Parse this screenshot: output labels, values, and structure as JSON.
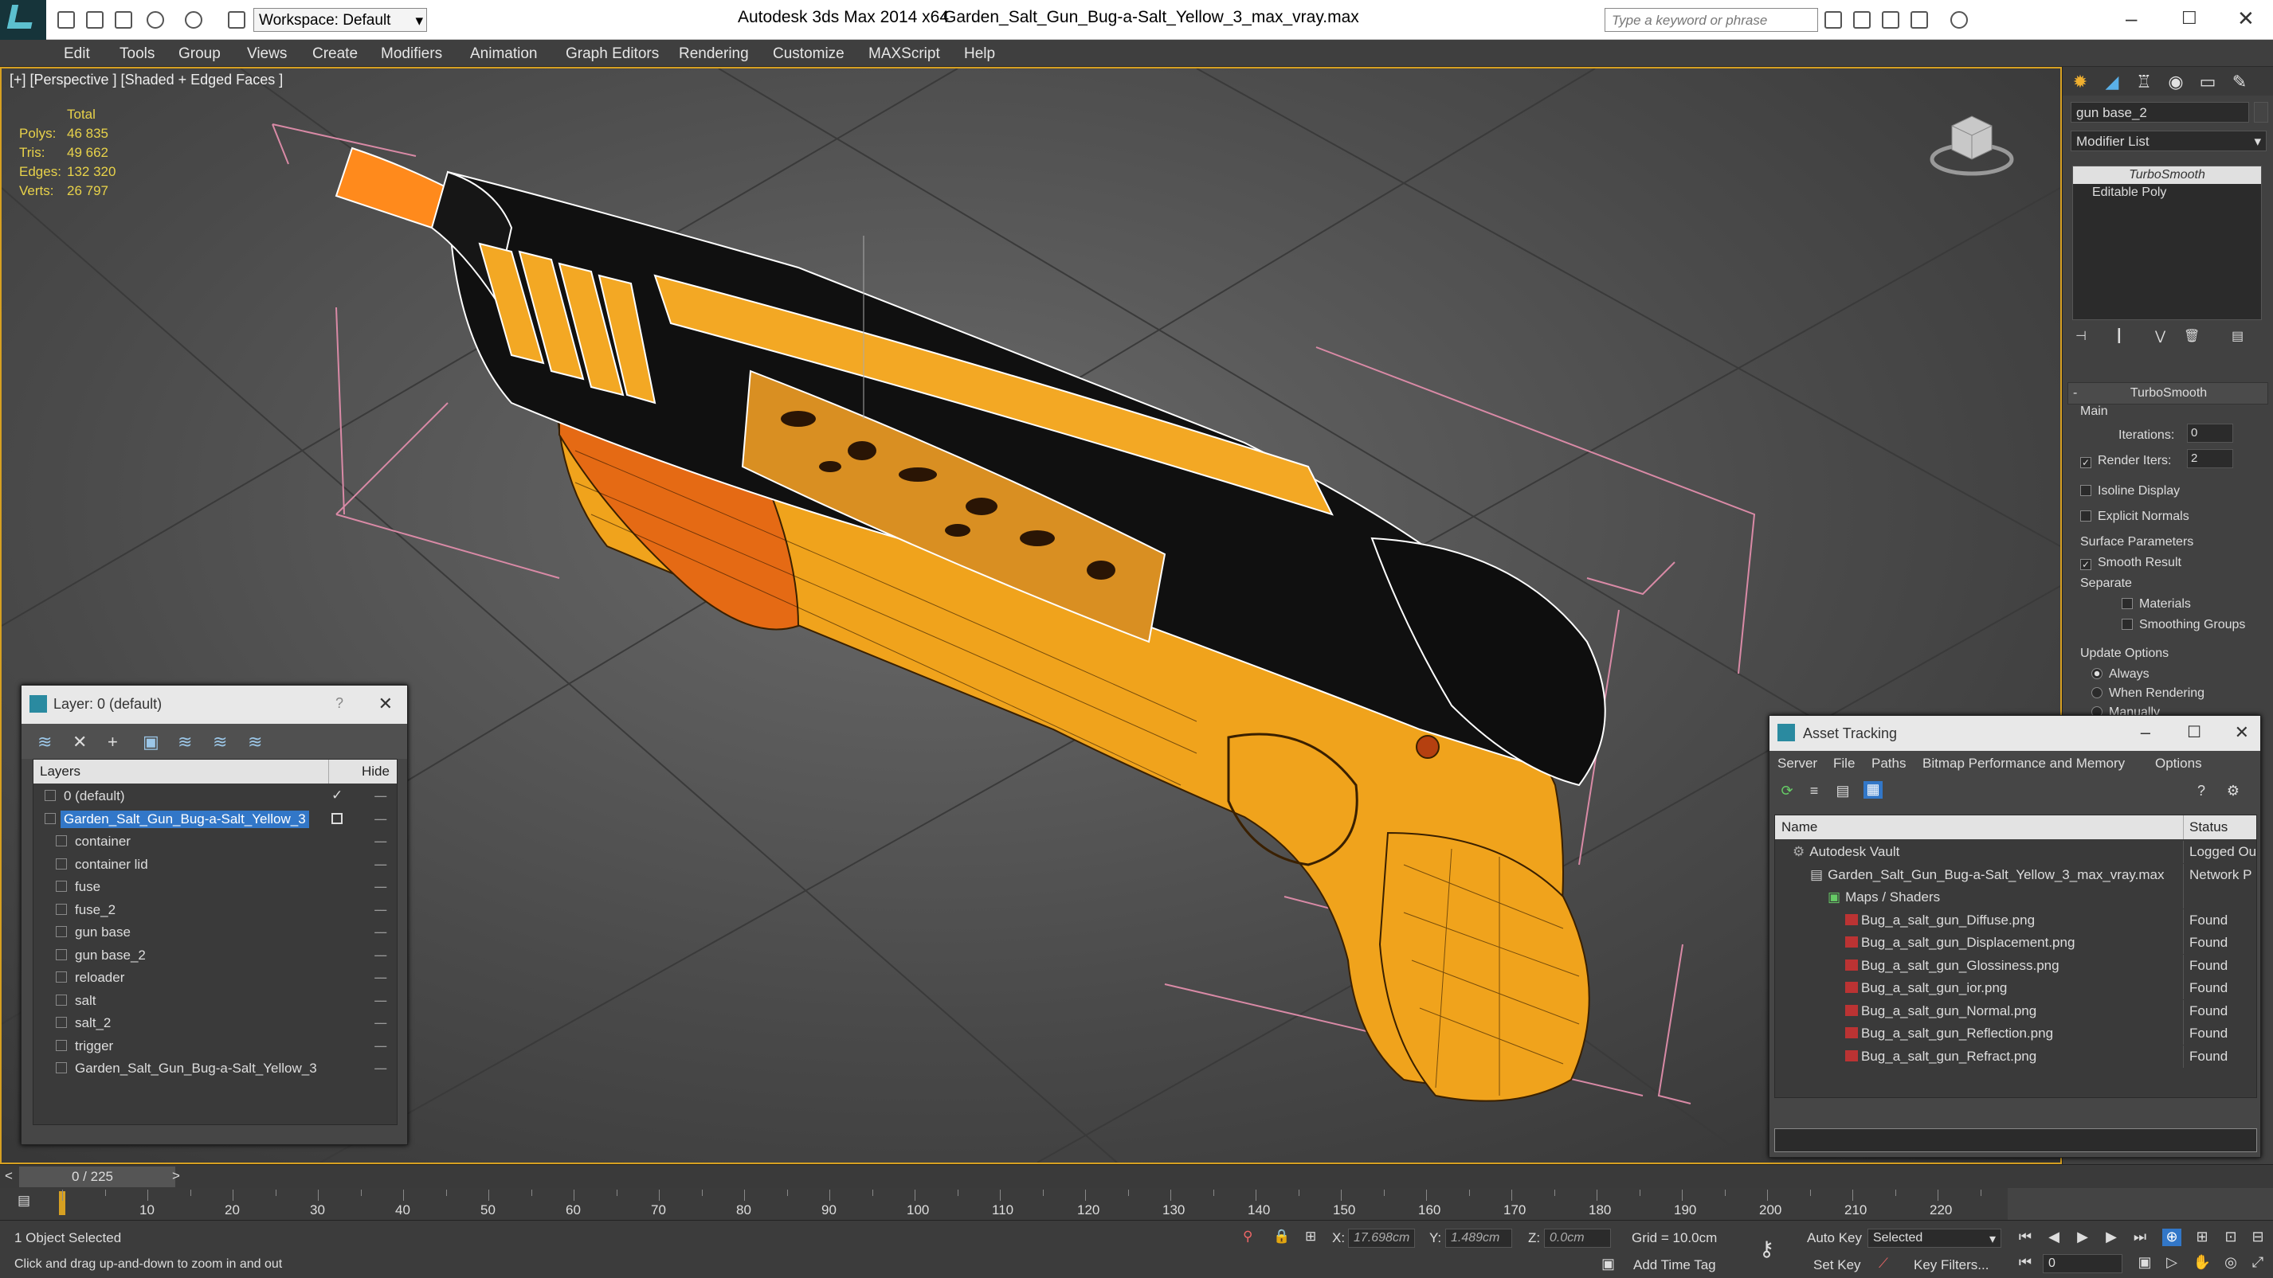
{
  "titlebar": {
    "app": "Autodesk 3ds Max  2014 x64",
    "file": "Garden_Salt_Gun_Bug-a-Salt_Yellow_3_max_vray.max",
    "workspace": "Workspace: Default",
    "search_placeholder": "Type a keyword or phrase"
  },
  "menu": [
    "Edit",
    "Tools",
    "Group",
    "Views",
    "Create",
    "Modifiers",
    "Animation",
    "Graph Editors",
    "Rendering",
    "Customize",
    "MAXScript",
    "Help"
  ],
  "viewport": {
    "label": "[+] [Perspective ] [Shaded + Edged Faces ]",
    "stats": {
      "header": "Total",
      "rows": [
        {
          "k": "Polys:",
          "v": "46 835"
        },
        {
          "k": "Tris:",
          "v": "49 662"
        },
        {
          "k": "Edges:",
          "v": "132 320"
        },
        {
          "k": "Verts:",
          "v": "26 797"
        }
      ]
    }
  },
  "layer_panel": {
    "title": "Layer: 0 (default)",
    "col_layers": "Layers",
    "col_hide": "Hide",
    "items": [
      {
        "name": "0 (default)",
        "level": 1,
        "selected": false,
        "check": true
      },
      {
        "name": "Garden_Salt_Gun_Bug-a-Salt_Yellow_3",
        "level": 1,
        "selected": true,
        "check": false
      },
      {
        "name": "container",
        "level": 2
      },
      {
        "name": "container lid",
        "level": 2
      },
      {
        "name": "fuse",
        "level": 2
      },
      {
        "name": "fuse_2",
        "level": 2
      },
      {
        "name": "gun base",
        "level": 2
      },
      {
        "name": "gun base_2",
        "level": 2
      },
      {
        "name": "reloader",
        "level": 2
      },
      {
        "name": "salt",
        "level": 2
      },
      {
        "name": "salt_2",
        "level": 2
      },
      {
        "name": "trigger",
        "level": 2
      },
      {
        "name": "Garden_Salt_Gun_Bug-a-Salt_Yellow_3",
        "level": 2
      }
    ]
  },
  "command_panel": {
    "object_name": "gun base_2",
    "modifier_list": "Modifier List",
    "stack": [
      "TurboSmooth",
      "Editable Poly"
    ],
    "rollout_title": "TurboSmooth",
    "main": "Main",
    "iterations_label": "Iterations:",
    "iterations_value": "0",
    "render_iters_label": "Render Iters:",
    "render_iters_value": "2",
    "isoline": "Isoline Display",
    "explicit_normals": "Explicit Normals",
    "surface_params": "Surface Parameters",
    "smooth_result": "Smooth Result",
    "separate": "Separate",
    "materials": "Materials",
    "smoothing_groups": "Smoothing Groups",
    "update_options": "Update Options",
    "always": "Always",
    "when_rendering": "When Rendering",
    "manually": "Manually"
  },
  "asset_tracking": {
    "title": "Asset Tracking",
    "menu": [
      "Server",
      "File",
      "Paths",
      "Bitmap Performance and Memory",
      "Options"
    ],
    "col_name": "Name",
    "col_status": "Status",
    "rows": [
      {
        "name": "Autodesk Vault",
        "status": "Logged Ou",
        "indent": 1,
        "type": "vault"
      },
      {
        "name": "Garden_Salt_Gun_Bug-a-Salt_Yellow_3_max_vray.max",
        "status": "Network P",
        "indent": 2,
        "type": "file"
      },
      {
        "name": "Maps / Shaders",
        "status": "",
        "indent": 3,
        "type": "folder"
      },
      {
        "name": "Bug_a_salt_gun_Diffuse.png",
        "status": "Found",
        "indent": 4,
        "type": "png"
      },
      {
        "name": "Bug_a_salt_gun_Displacement.png",
        "status": "Found",
        "indent": 4,
        "type": "png"
      },
      {
        "name": "Bug_a_salt_gun_Glossiness.png",
        "status": "Found",
        "indent": 4,
        "type": "png"
      },
      {
        "name": "Bug_a_salt_gun_ior.png",
        "status": "Found",
        "indent": 4,
        "type": "png"
      },
      {
        "name": "Bug_a_salt_gun_Normal.png",
        "status": "Found",
        "indent": 4,
        "type": "png"
      },
      {
        "name": "Bug_a_salt_gun_Reflection.png",
        "status": "Found",
        "indent": 4,
        "type": "png"
      },
      {
        "name": "Bug_a_salt_gun_Refract.png",
        "status": "Found",
        "indent": 4,
        "type": "png"
      }
    ]
  },
  "timeline": {
    "frame": "0 / 225",
    "ticks": [
      "10",
      "20",
      "30",
      "40",
      "50",
      "60",
      "70",
      "80",
      "90",
      "100",
      "110",
      "120",
      "130",
      "140",
      "150",
      "160",
      "170",
      "180",
      "190",
      "200",
      "210",
      "220"
    ]
  },
  "status": {
    "selected": "1 Object Selected",
    "hint": "Click and drag up-and-down to zoom in and out",
    "x_label": "X:",
    "x_value": "17.698cm",
    "y_label": "Y:",
    "y_value": "1.489cm",
    "z_label": "Z:",
    "z_value": "0.0cm",
    "grid": "Grid = 10.0cm",
    "add_time_tag": "Add Time Tag",
    "auto_key": "Auto Key",
    "selected_dropdown": "Selected",
    "set_key": "Set Key",
    "key_filters": "Key Filters...",
    "frame_value": "0"
  },
  "colors": {
    "accent": "#3277c8",
    "gun_orange": "#f0a31c",
    "viewport_border": "#d6a022",
    "stats_text": "#e8d24a"
  }
}
